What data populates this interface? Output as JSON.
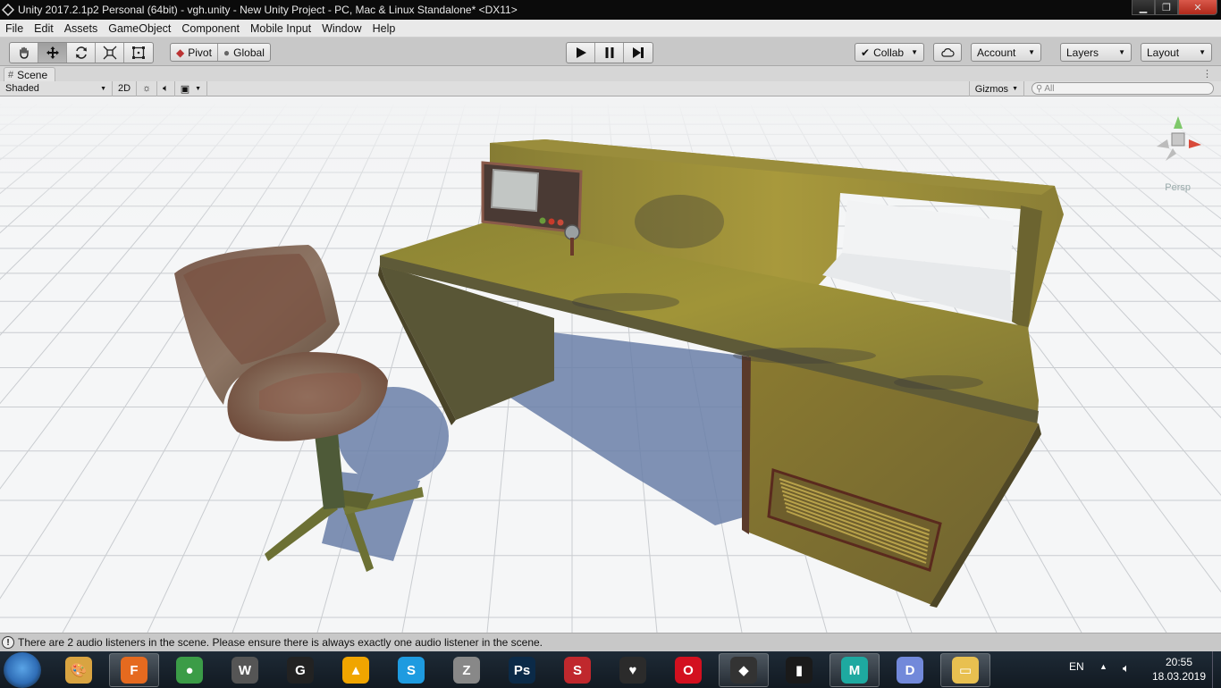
{
  "window": {
    "title": "Unity 2017.2.1p2 Personal (64bit) - vgh.unity - New Unity Project - PC, Mac & Linux Standalone* <DX11>",
    "minimize_icon": "minimize-icon",
    "maximize_icon": "restore-icon",
    "close_icon": "close-icon"
  },
  "menu": [
    "File",
    "Edit",
    "Assets",
    "GameObject",
    "Component",
    "Mobile Input",
    "Window",
    "Help"
  ],
  "toolbar": {
    "tools": [
      "hand-tool-icon",
      "move-tool-icon",
      "rotate-tool-icon",
      "scale-tool-icon",
      "rect-tool-icon"
    ],
    "active_tool_index": 1,
    "pivot_label": "Pivot",
    "global_label": "Global",
    "collab_label": "Collab",
    "account_label": "Account",
    "layers_label": "Layers",
    "layout_label": "Layout"
  },
  "scene_tab": {
    "label": "Scene"
  },
  "scene_toolbar": {
    "shading_mode": "Shaded",
    "mode_2d_label": "2D",
    "gizmos_label": "Gizmos",
    "search_placeholder": "All"
  },
  "scene": {
    "camera_label": "Persp"
  },
  "status": {
    "message": "There are 2 audio listeners in the scene. Please ensure there is always exactly one audio listener in the scene."
  },
  "taskbar": {
    "apps": [
      {
        "name": "paint-icon",
        "color": "#d9a441",
        "glyph": "🎨"
      },
      {
        "name": "firefox-icon",
        "color": "#e56a1f",
        "glyph": "F"
      },
      {
        "name": "chrome-icon",
        "color": "#3b9c47",
        "glyph": "●"
      },
      {
        "name": "world-of-tanks-icon",
        "color": "#555555",
        "glyph": "W"
      },
      {
        "name": "epic-games-icon",
        "color": "#222222",
        "glyph": "G"
      },
      {
        "name": "artrage-icon",
        "color": "#f0a500",
        "glyph": "▲"
      },
      {
        "name": "skype-icon",
        "color": "#1e9be0",
        "glyph": "S"
      },
      {
        "name": "zbrush-icon",
        "color": "#888888",
        "glyph": "Z"
      },
      {
        "name": "photoshop-icon",
        "color": "#0b2a48",
        "glyph": "Ps"
      },
      {
        "name": "substance-painter-icon",
        "color": "#c0282d",
        "glyph": "S"
      },
      {
        "name": "marmoset-icon",
        "color": "#2b2b2b",
        "glyph": "♥"
      },
      {
        "name": "opera-icon",
        "color": "#d3101f",
        "glyph": "O"
      },
      {
        "name": "unity-icon",
        "color": "#333333",
        "glyph": "◆"
      },
      {
        "name": "audio-app-icon",
        "color": "#1a1a1a",
        "glyph": "▮"
      },
      {
        "name": "maya-icon",
        "color": "#1ea9a0",
        "glyph": "M"
      },
      {
        "name": "discord-icon",
        "color": "#7289da",
        "glyph": "D"
      },
      {
        "name": "explorer-icon",
        "color": "#e8c050",
        "glyph": "▭"
      }
    ],
    "active_indices": [
      1,
      12,
      14,
      16
    ],
    "language": "EN",
    "time": "20:55",
    "date": "18.03.2019"
  }
}
